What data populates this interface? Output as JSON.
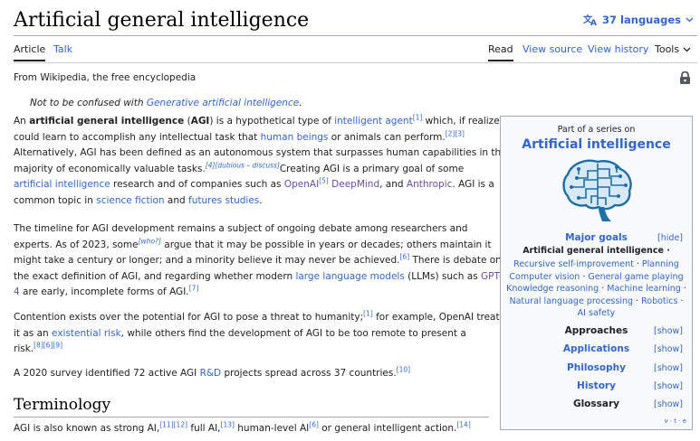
{
  "header": {
    "title": "Artificial general intelligence",
    "languages_label": "37 languages"
  },
  "tabs": {
    "article": "Article",
    "talk": "Talk",
    "read": "Read",
    "view_source": "View source",
    "view_history": "View history",
    "tools": "Tools"
  },
  "tagline": "From Wikipedia, the free encyclopedia",
  "hatnote": {
    "prefix": "Not to be confused with ",
    "link": "Generative artificial intelligence",
    "suffix": "."
  },
  "body": {
    "p1": {
      "l1_a": "An ",
      "l1_b": "artificial general intelligence",
      "l1_c": " (",
      "l1_d": "AGI",
      "l1_e": ") is a hypothetical type of ",
      "l1_link": "intelligent agent",
      "l1_ref": "[1]",
      "l1_f": " which, if realized,",
      "l2_a": "could learn to accomplish any intellectual task that ",
      "l2_link": "human beings",
      "l2_b": " or animals can perform.",
      "l2_ref": "[2][3]",
      "l3": "Alternatively, AGI has been defined as an autonomous system that surpasses human capabilities in the",
      "l4_a": "majority of economically valuable tasks.",
      "l4_ref": "[4][dubious – discuss]",
      "l4_b": "Creating AGI is a primary goal of some",
      "l5_link1": "artificial intelligence",
      "l5_a": " research and of companies such as ",
      "l5_link2": "OpenAI",
      "l5_ref": "[5]",
      "l5_b": " ",
      "l5_link3": "DeepMind",
      "l5_c": ", and ",
      "l5_link4": "Anthropic",
      "l5_d": ". AGI is a",
      "l6_a": "common topic in ",
      "l6_link1": "science fiction",
      "l6_b": " and ",
      "l6_link2": "futures studies",
      "l6_c": "."
    },
    "p2": {
      "l1": "The timeline for AGI development remains a subject of ongoing debate among researchers and",
      "l2_a": "experts. As of 2023, some",
      "l2_ref": "[who?]",
      "l2_b": " argue that it may be possible in years or decades; others maintain it",
      "l3_a": "might take a century or longer; and a minority believe it may never be achieved.",
      "l3_ref": "[6]",
      "l3_b": " There is debate on",
      "l4_a": "the exact definition of AGI, and regarding whether modern ",
      "l4_link1": "large language models",
      "l4_b": " (LLMs) such as ",
      "l4_link2": "GPT-",
      "l5_link": "4",
      "l5_a": " are early, incomplete forms of AGI.",
      "l5_ref": "[7]"
    },
    "p3": {
      "l1_a": "Contention exists over the potential for AGI to pose a threat to humanity;",
      "l1_ref": "[1]",
      "l1_b": " for example, OpenAI treats",
      "l2_a": "it as an ",
      "l2_link": "existential risk",
      "l2_b": ", while others find the development of AGI to be too remote to present a",
      "l3_a": "risk.",
      "l3_ref": "[8][6][9]"
    },
    "p4": {
      "a": "A 2020 survey identified 72 active AGI ",
      "link": "R&D",
      "b": " projects spread across 37 countries.",
      "ref": "[10]"
    },
    "terminology_heading": "Terminology",
    "p5": {
      "a": "AGI is also known as strong AI,",
      "ref1": "[11][12]",
      "b": " full AI,",
      "ref2": "[13]",
      "c": " human-level AI",
      "ref3": "[6]",
      "d": " or general intelligent action.",
      "ref4": "[14]"
    }
  },
  "infobox": {
    "part_of": "Part of a series on",
    "title": "Artificial intelligence",
    "major_goals": "Major goals",
    "hide": "[hide]",
    "agi_item": "Artificial general intelligence ·",
    "major_lines": [
      {
        "a": "Recursive self-improvement",
        "b": "Planning",
        "c": null
      },
      {
        "a": "Computer vision",
        "b": "General game playing",
        "c": null
      },
      {
        "a": "Knowledge reasoning",
        "b": "Machine learning",
        "c": null
      },
      {
        "a": "Natural language processing",
        "b": "Robotics",
        "c": null
      },
      {
        "a": "AI safety",
        "b": null,
        "c": null
      }
    ],
    "sections": {
      "approaches": "Approaches",
      "applications": "Applications",
      "philosophy": "Philosophy",
      "history": "History",
      "glossary": "Glossary"
    },
    "show": "[show]",
    "vte": "v · t · e"
  },
  "colors": {
    "link": "#3366cc",
    "visited": "#6b4ba1",
    "brain": "#1d6fa5"
  },
  "icons": [
    "translate-icon",
    "chevron-down-icon",
    "lock-icon",
    "brain-circuit-icon"
  ]
}
